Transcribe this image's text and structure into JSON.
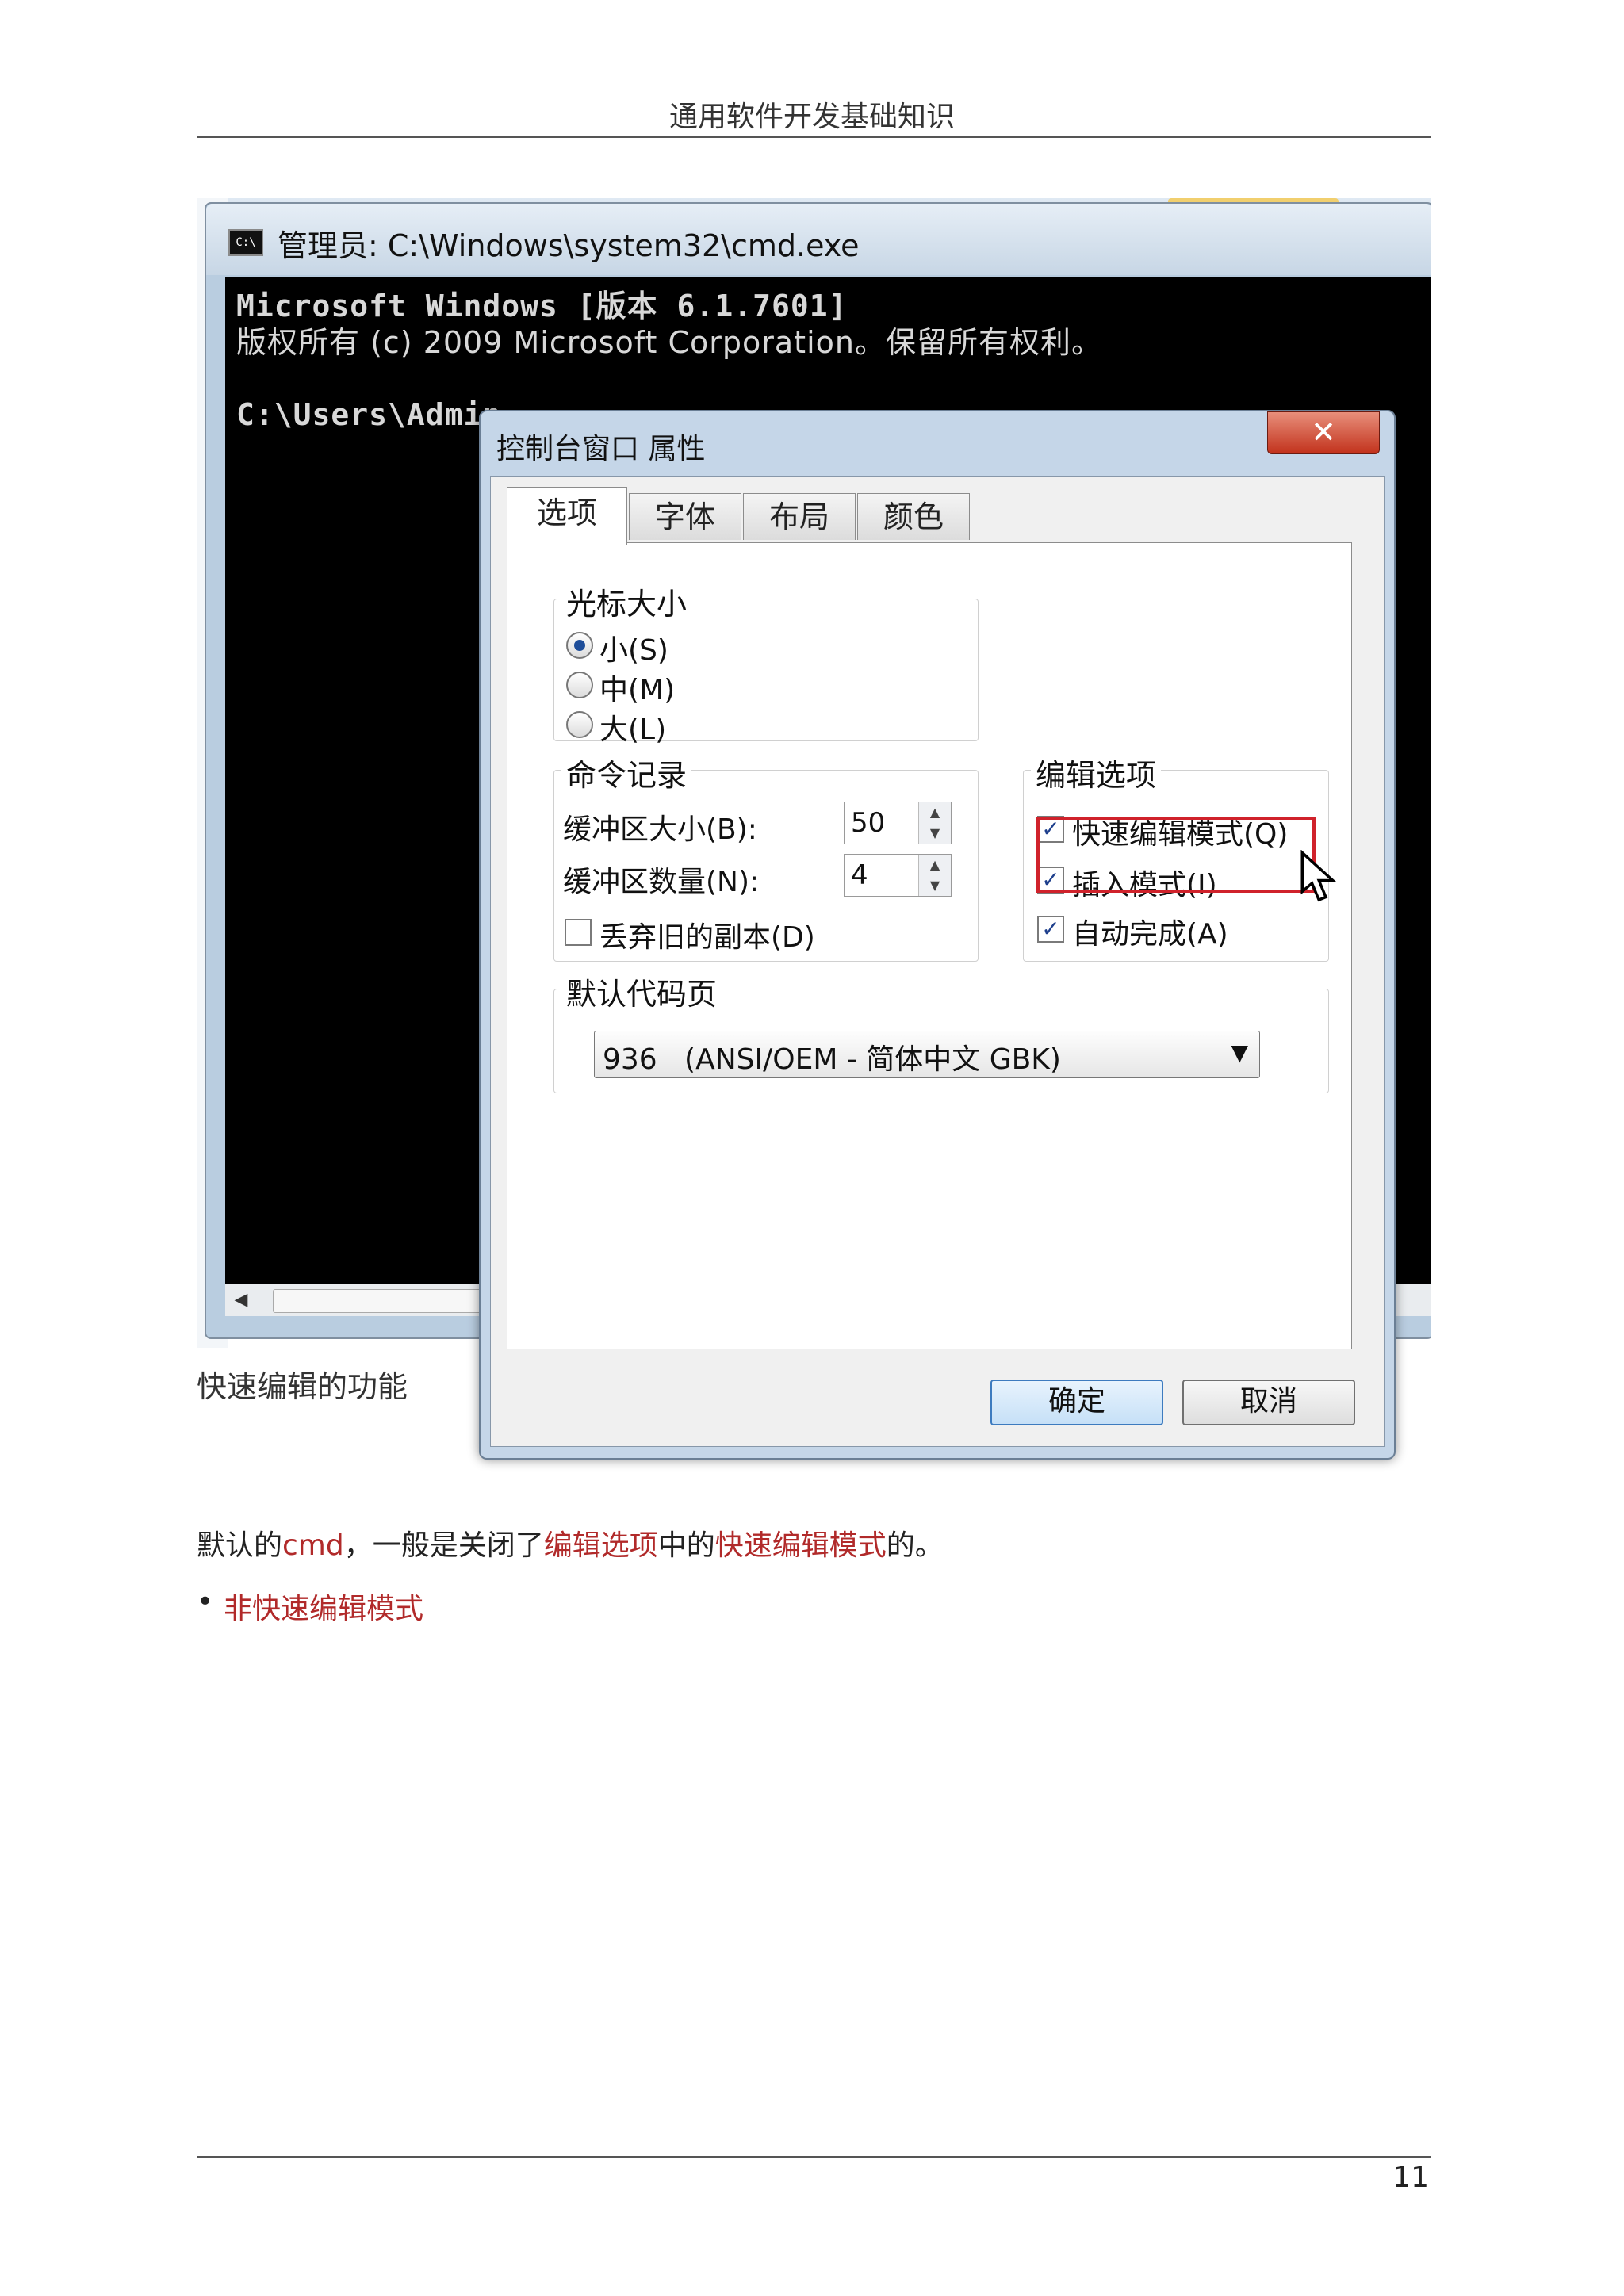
{
  "header": {
    "title": "通用软件开发基础知识"
  },
  "cmd_window": {
    "title": "管理员: C:\\Windows\\system32\\cmd.exe",
    "icon_text": "C:\\",
    "console_lines": [
      "Microsoft Windows [版本 6.1.7601]",
      "版权所有 (c) 2009 Microsoft Corporation。保留所有权利。",
      "",
      "C:\\Users\\Admin"
    ],
    "scroll_left": "◀"
  },
  "caption": "快速编辑的功能",
  "dialog": {
    "title": "控制台窗口 属性",
    "close_label": "✕",
    "tabs": [
      "选项",
      "字体",
      "布局",
      "颜色"
    ],
    "cursor_size": {
      "legend": "光标大小",
      "options": [
        "小(S)",
        "中(M)",
        "大(L)"
      ],
      "selected": "小(S)"
    },
    "command_history": {
      "legend": "命令记录",
      "buffer_size_label": "缓冲区大小(B):",
      "buffer_size_value": "50",
      "buffer_count_label": "缓冲区数量(N):",
      "buffer_count_value": "4",
      "discard_label": "丢弃旧的副本(D)",
      "discard_checked": false
    },
    "edit_options": {
      "legend": "编辑选项",
      "items": [
        {
          "label": "快速编辑模式(Q)",
          "checked": true
        },
        {
          "label": "插入模式(I)",
          "checked": true
        },
        {
          "label": "自动完成(A)",
          "checked": true
        }
      ]
    },
    "code_page": {
      "legend": "默认代码页",
      "value": "936   (ANSI/OEM - 简体中文 GBK)"
    },
    "ok_label": "确定",
    "cancel_label": "取消"
  },
  "body": {
    "p1_a": "默认的",
    "p1_b": "cmd",
    "p1_c": "，一般是关闭了",
    "p1_d": "编辑选项",
    "p1_e": "中的",
    "p1_f": "快速编辑模式",
    "p1_g": "的。",
    "bullet": "非快速编辑模式"
  },
  "footer": {
    "page_number": "11"
  },
  "colors": {
    "accent_red": "#b12a2a",
    "highlight": "#d0222b"
  }
}
